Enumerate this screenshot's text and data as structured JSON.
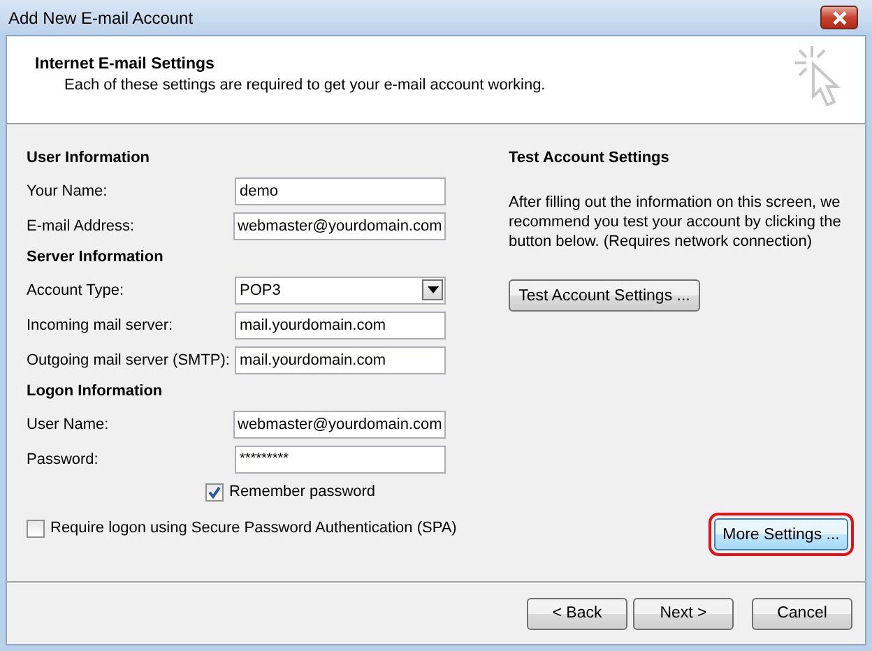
{
  "window": {
    "title": "Add New E-mail Account"
  },
  "header": {
    "title": "Internet E-mail Settings",
    "subtitle": "Each of these settings are required to get your e-mail account working."
  },
  "sections": [
    {
      "title": "User Information",
      "fields": [
        {
          "label": "Your Name:",
          "kind": "text",
          "value": "demo"
        },
        {
          "label": "E-mail Address:",
          "kind": "text",
          "value": "webmaster@yourdomain.com"
        }
      ]
    },
    {
      "title": "Server Information",
      "fields": [
        {
          "label": "Account Type:",
          "kind": "dropdown",
          "value": "POP3"
        },
        {
          "label": "Incoming mail server:",
          "kind": "text",
          "value": "mail.yourdomain.com"
        },
        {
          "label": "Outgoing mail server (SMTP):",
          "kind": "text",
          "value": "mail.yourdomain.com"
        }
      ]
    },
    {
      "title": "Logon Information",
      "fields": [
        {
          "label": "User Name:",
          "kind": "text",
          "value": "webmaster@yourdomain.com"
        },
        {
          "label": "Password:",
          "kind": "password",
          "value": "*********"
        }
      ]
    }
  ],
  "remember_password": {
    "label": "Remember password",
    "checked": true
  },
  "require_spa": {
    "label": "Require logon using Secure Password Authentication (SPA)",
    "checked": false
  },
  "test": {
    "title": "Test Account Settings",
    "text": "After filling out the information on this screen, we recommend you test your account by clicking the button below. (Requires network connection)",
    "button": "Test Account Settings ..."
  },
  "more_settings": {
    "label": "More Settings ...",
    "highlighted": true
  },
  "buttons": [
    {
      "label": "< Back"
    },
    {
      "label": "Next >"
    },
    {
      "label": "Cancel"
    }
  ]
}
